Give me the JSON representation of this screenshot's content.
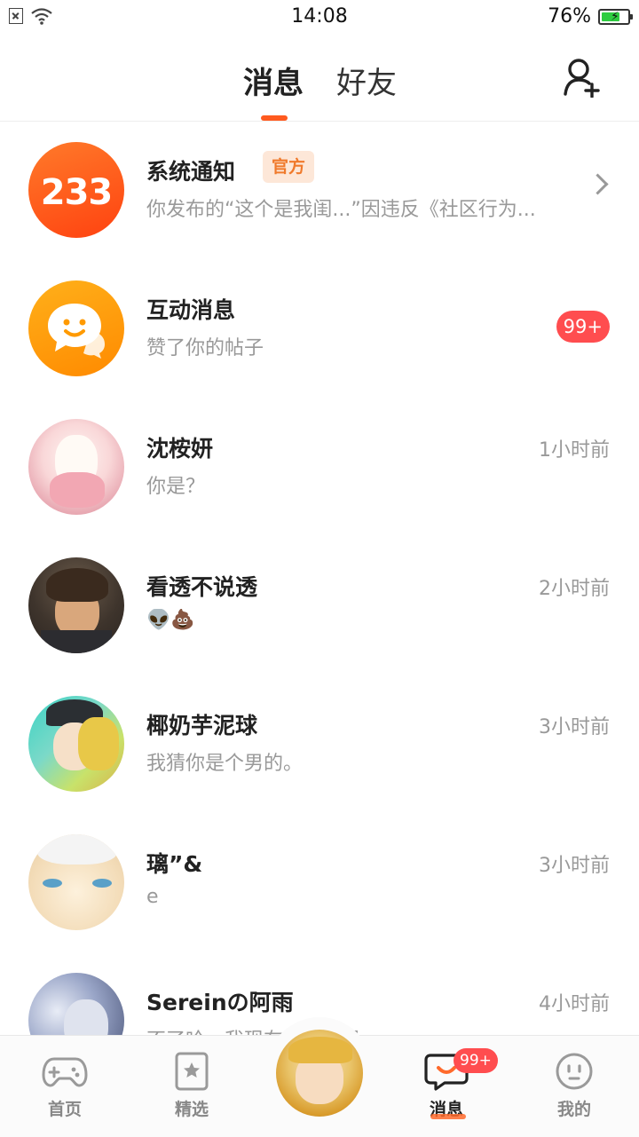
{
  "status_bar": {
    "time": "14:08",
    "battery": "76%",
    "battery_level": 0.76
  },
  "header": {
    "tab_messages": "消息",
    "tab_friends": "好友"
  },
  "conversations": [
    {
      "name": "系统通知",
      "badge": "官方",
      "preview": "你发布的“这个是我闺...”因违反《社区行为...",
      "avatar_text": "233"
    },
    {
      "name": "互动消息",
      "preview": "赞了你的帖子",
      "count": "99+"
    },
    {
      "name": "沈桉妍",
      "preview": "你是？",
      "time": "1小时前"
    },
    {
      "name": "看透不说透",
      "preview": "👽💩",
      "time": "2小时前"
    },
    {
      "name": "椰奶芋泥球",
      "preview": "我猜你是个男的。",
      "time": "3小时前"
    },
    {
      "name": "璃”&",
      "preview": "e",
      "time": "3小时前"
    },
    {
      "name": "Sereinの阿雨",
      "preview": "不了哈，我现在…交合号",
      "time": "4小时前"
    }
  ],
  "bottom_nav": {
    "home": "首页",
    "featured": "精选",
    "messages": "消息",
    "messages_badge": "99+",
    "mine": "我的"
  },
  "colors": {
    "accent": "#ff5a1f",
    "badge_red": "#ff4d4f",
    "official_bg": "#fde7d8"
  }
}
